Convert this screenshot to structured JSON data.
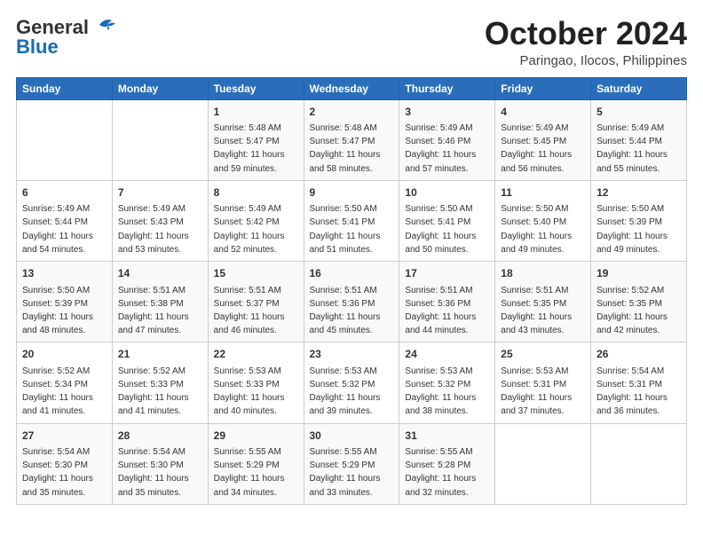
{
  "header": {
    "logo_line1": "General",
    "logo_line2": "Blue",
    "month": "October 2024",
    "location": "Paringao, Ilocos, Philippines"
  },
  "weekdays": [
    "Sunday",
    "Monday",
    "Tuesday",
    "Wednesday",
    "Thursday",
    "Friday",
    "Saturday"
  ],
  "weeks": [
    [
      {
        "day": "",
        "detail": ""
      },
      {
        "day": "",
        "detail": ""
      },
      {
        "day": "1",
        "detail": "Sunrise: 5:48 AM\nSunset: 5:47 PM\nDaylight: 11 hours\nand 59 minutes."
      },
      {
        "day": "2",
        "detail": "Sunrise: 5:48 AM\nSunset: 5:47 PM\nDaylight: 11 hours\nand 58 minutes."
      },
      {
        "day": "3",
        "detail": "Sunrise: 5:49 AM\nSunset: 5:46 PM\nDaylight: 11 hours\nand 57 minutes."
      },
      {
        "day": "4",
        "detail": "Sunrise: 5:49 AM\nSunset: 5:45 PM\nDaylight: 11 hours\nand 56 minutes."
      },
      {
        "day": "5",
        "detail": "Sunrise: 5:49 AM\nSunset: 5:44 PM\nDaylight: 11 hours\nand 55 minutes."
      }
    ],
    [
      {
        "day": "6",
        "detail": "Sunrise: 5:49 AM\nSunset: 5:44 PM\nDaylight: 11 hours\nand 54 minutes."
      },
      {
        "day": "7",
        "detail": "Sunrise: 5:49 AM\nSunset: 5:43 PM\nDaylight: 11 hours\nand 53 minutes."
      },
      {
        "day": "8",
        "detail": "Sunrise: 5:49 AM\nSunset: 5:42 PM\nDaylight: 11 hours\nand 52 minutes."
      },
      {
        "day": "9",
        "detail": "Sunrise: 5:50 AM\nSunset: 5:41 PM\nDaylight: 11 hours\nand 51 minutes."
      },
      {
        "day": "10",
        "detail": "Sunrise: 5:50 AM\nSunset: 5:41 PM\nDaylight: 11 hours\nand 50 minutes."
      },
      {
        "day": "11",
        "detail": "Sunrise: 5:50 AM\nSunset: 5:40 PM\nDaylight: 11 hours\nand 49 minutes."
      },
      {
        "day": "12",
        "detail": "Sunrise: 5:50 AM\nSunset: 5:39 PM\nDaylight: 11 hours\nand 49 minutes."
      }
    ],
    [
      {
        "day": "13",
        "detail": "Sunrise: 5:50 AM\nSunset: 5:39 PM\nDaylight: 11 hours\nand 48 minutes."
      },
      {
        "day": "14",
        "detail": "Sunrise: 5:51 AM\nSunset: 5:38 PM\nDaylight: 11 hours\nand 47 minutes."
      },
      {
        "day": "15",
        "detail": "Sunrise: 5:51 AM\nSunset: 5:37 PM\nDaylight: 11 hours\nand 46 minutes."
      },
      {
        "day": "16",
        "detail": "Sunrise: 5:51 AM\nSunset: 5:36 PM\nDaylight: 11 hours\nand 45 minutes."
      },
      {
        "day": "17",
        "detail": "Sunrise: 5:51 AM\nSunset: 5:36 PM\nDaylight: 11 hours\nand 44 minutes."
      },
      {
        "day": "18",
        "detail": "Sunrise: 5:51 AM\nSunset: 5:35 PM\nDaylight: 11 hours\nand 43 minutes."
      },
      {
        "day": "19",
        "detail": "Sunrise: 5:52 AM\nSunset: 5:35 PM\nDaylight: 11 hours\nand 42 minutes."
      }
    ],
    [
      {
        "day": "20",
        "detail": "Sunrise: 5:52 AM\nSunset: 5:34 PM\nDaylight: 11 hours\nand 41 minutes."
      },
      {
        "day": "21",
        "detail": "Sunrise: 5:52 AM\nSunset: 5:33 PM\nDaylight: 11 hours\nand 41 minutes."
      },
      {
        "day": "22",
        "detail": "Sunrise: 5:53 AM\nSunset: 5:33 PM\nDaylight: 11 hours\nand 40 minutes."
      },
      {
        "day": "23",
        "detail": "Sunrise: 5:53 AM\nSunset: 5:32 PM\nDaylight: 11 hours\nand 39 minutes."
      },
      {
        "day": "24",
        "detail": "Sunrise: 5:53 AM\nSunset: 5:32 PM\nDaylight: 11 hours\nand 38 minutes."
      },
      {
        "day": "25",
        "detail": "Sunrise: 5:53 AM\nSunset: 5:31 PM\nDaylight: 11 hours\nand 37 minutes."
      },
      {
        "day": "26",
        "detail": "Sunrise: 5:54 AM\nSunset: 5:31 PM\nDaylight: 11 hours\nand 36 minutes."
      }
    ],
    [
      {
        "day": "27",
        "detail": "Sunrise: 5:54 AM\nSunset: 5:30 PM\nDaylight: 11 hours\nand 35 minutes."
      },
      {
        "day": "28",
        "detail": "Sunrise: 5:54 AM\nSunset: 5:30 PM\nDaylight: 11 hours\nand 35 minutes."
      },
      {
        "day": "29",
        "detail": "Sunrise: 5:55 AM\nSunset: 5:29 PM\nDaylight: 11 hours\nand 34 minutes."
      },
      {
        "day": "30",
        "detail": "Sunrise: 5:55 AM\nSunset: 5:29 PM\nDaylight: 11 hours\nand 33 minutes."
      },
      {
        "day": "31",
        "detail": "Sunrise: 5:55 AM\nSunset: 5:28 PM\nDaylight: 11 hours\nand 32 minutes."
      },
      {
        "day": "",
        "detail": ""
      },
      {
        "day": "",
        "detail": ""
      }
    ]
  ]
}
